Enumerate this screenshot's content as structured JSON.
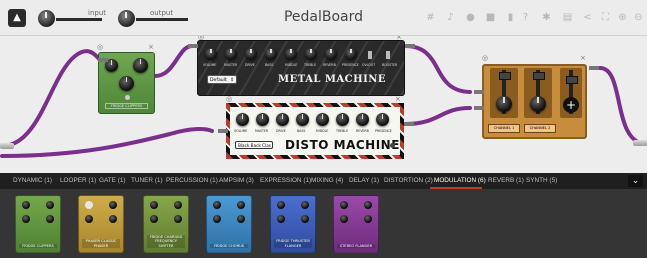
{
  "header": {
    "title": "PedalBoard",
    "input_label": "input",
    "output_label": "output",
    "toolbar_icons": [
      "grid-icon",
      "tuner-icon",
      "microphone-icon",
      "save-icon",
      "trash-icon",
      "help-icon",
      "puzzle-icon",
      "bank-icon",
      "share-icon",
      "fullscreen-icon",
      "zoom-in-icon",
      "zoom-out-icon"
    ]
  },
  "board": {
    "cable_color": "#7a2f8c",
    "pedals": {
      "green": {
        "label": "FRIDGE CLIPPERS",
        "color": "#5f9a46"
      },
      "metal": {
        "title": "METAL MACHINE",
        "preset": "Default",
        "knob_labels": [
          "VOLUME",
          "MASTER",
          "DRIVE",
          "BASS",
          "MIDDLE",
          "TREBLE",
          "REVERB",
          "PRESENCE"
        ],
        "switch_labels": [
          "OVLOOT",
          "BOOSTER"
        ]
      },
      "disto": {
        "title": "DISTO MACHINE",
        "preset": "Black Back Clas",
        "knob_labels": [
          "VOLUME",
          "MASTER",
          "DRIVE",
          "BASS",
          "MIDDLE",
          "TREBLE",
          "REVERB",
          "PRESENCE"
        ]
      },
      "mixer": {
        "channel_1": "CHANNEL 1",
        "channel_2": "CHANNEL 2"
      }
    }
  },
  "categories": {
    "tabs": [
      "DYNAMIC (1)",
      "LOOPER (1)",
      "GATE (1)",
      "TUNER (1)",
      "PERCUSSION (1)",
      "AMPSIM (3)",
      "EXPRESSION (1)",
      "MIXING (4)",
      "DELAY (1)",
      "DISTORTION (2)",
      "MODULATION (6)",
      "REVERB (1)",
      "SYNTH (5)"
    ],
    "active_index": 10,
    "accent": "#c0392b"
  },
  "tray": {
    "plugins": [
      {
        "name": "FRIDGE CLIPPERS",
        "color": "#6a9e42"
      },
      {
        "name": "PHASER CLASSIC PHASER",
        "color": "#c7a43f"
      },
      {
        "name": "FRIDGE CHARGED FREQUENCY SHIFTER",
        "color": "#7a9a3c"
      },
      {
        "name": "FRIDGE CHORUS",
        "color": "#3f8fc9"
      },
      {
        "name": "FRIDGE THRUSTER FLANGER",
        "color": "#3f62bf"
      },
      {
        "name": "STEREO FLANGER",
        "color": "#8a3f9a"
      }
    ]
  }
}
